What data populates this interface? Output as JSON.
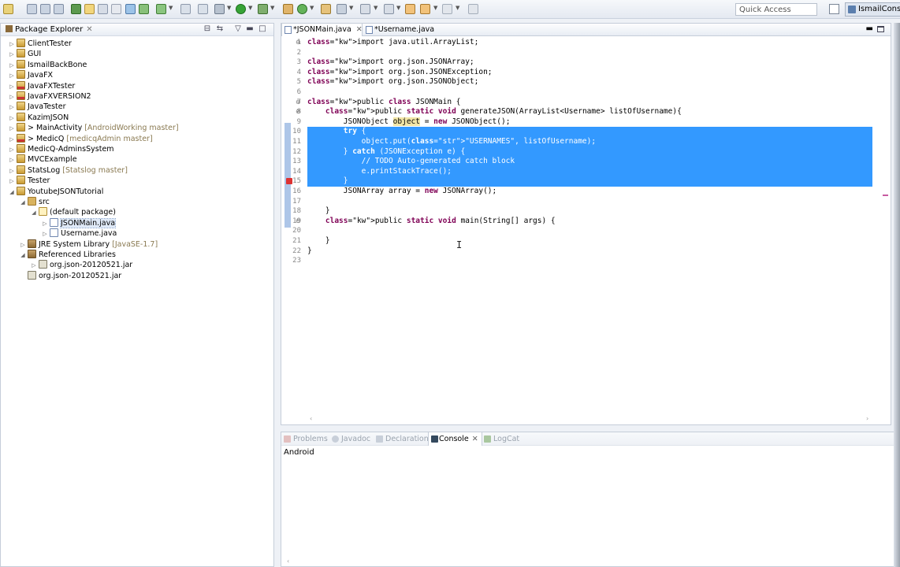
{
  "toolbar": {
    "quick_access_placeholder": "Quick Access",
    "perspective_label": "IsmailCons"
  },
  "package_explorer": {
    "title": "Package Explorer",
    "items": [
      {
        "label": "ClientTester",
        "deco": "",
        "icon": "project-icon",
        "twisty": "▷"
      },
      {
        "label": "GUI",
        "deco": "",
        "icon": "project-icon",
        "twisty": "▷"
      },
      {
        "label": "IsmailBackBone",
        "deco": "",
        "icon": "project-icon",
        "twisty": "▷"
      },
      {
        "label": "JavaFX",
        "deco": "",
        "icon": "project-icon",
        "twisty": "▷"
      },
      {
        "label": "JavaFXTester",
        "deco": "",
        "icon": "project-error-icon",
        "twisty": "▷"
      },
      {
        "label": "JavaFXVERSION2",
        "deco": "",
        "icon": "project-error-icon",
        "twisty": "▷"
      },
      {
        "label": "JavaTester",
        "deco": "",
        "icon": "project-icon",
        "twisty": "▷"
      },
      {
        "label": "KazimJSON",
        "deco": "",
        "icon": "project-icon",
        "twisty": "▷"
      },
      {
        "label": "> MainActivity",
        "deco": "[AndroidWorking master]",
        "icon": "project-icon",
        "twisty": "▷"
      },
      {
        "label": "> MedicQ",
        "deco": "[medicqAdmin master]",
        "icon": "project-error-icon",
        "twisty": "▷"
      },
      {
        "label": "MedicQ-AdminsSystem",
        "deco": "",
        "icon": "project-icon",
        "twisty": "▷"
      },
      {
        "label": "MVCExample",
        "deco": "",
        "icon": "project-icon",
        "twisty": "▷"
      },
      {
        "label": "StatsLog",
        "deco": "[Statslog master]",
        "icon": "project-icon",
        "twisty": "▷"
      },
      {
        "label": "Tester",
        "deco": "",
        "icon": "project-icon",
        "twisty": "▷"
      },
      {
        "label": "YoutubeJSONTutorial",
        "deco": "",
        "icon": "project-icon",
        "twisty": "◢"
      },
      {
        "label": "src",
        "deco": "",
        "icon": "source-folder-icon",
        "twisty": "◢"
      },
      {
        "label": "(default package)",
        "deco": "",
        "icon": "package-icon",
        "twisty": "◢"
      },
      {
        "label": "JSONMain.java",
        "deco": "",
        "icon": "java-file-icon",
        "twisty": "▷"
      },
      {
        "label": "Username.java",
        "deco": "",
        "icon": "java-file-icon",
        "twisty": "▷"
      },
      {
        "label": "JRE System Library",
        "deco": "[JavaSE-1.7]",
        "icon": "library-icon",
        "twisty": "▷"
      },
      {
        "label": "Referenced Libraries",
        "deco": "",
        "icon": "library-icon",
        "twisty": "◢"
      },
      {
        "label": "org.json-20120521.jar",
        "deco": "",
        "icon": "jar-icon",
        "twisty": "▷"
      },
      {
        "label": "org.json-20120521.jar",
        "deco": "",
        "icon": "jar-icon",
        "twisty": ""
      }
    ]
  },
  "editor": {
    "tabs": [
      {
        "label": "*JSONMain.java",
        "active": true
      },
      {
        "label": "*Username.java",
        "active": false
      }
    ],
    "line_numbers": [
      "1",
      "2",
      "3",
      "4",
      "5",
      "6",
      "7",
      "8",
      "9",
      "10",
      "11",
      "12",
      "13",
      "14",
      "15",
      "16",
      "17",
      "18",
      "19",
      "20",
      "21",
      "22",
      "23"
    ],
    "lines": [
      "import java.util.ArrayList;",
      "",
      "import org.json.JSONArray;",
      "import org.json.JSONException;",
      "import org.json.JSONObject;",
      "",
      "public class JSONMain {",
      "    public static void generateJSON(ArrayList<Username> listOfUsername){",
      "        JSONObject object = new JSONObject();",
      "        try {",
      "            object.put(\"USERNAMES\", listOfUsername);",
      "        } catch (JSONException e) {",
      "            // TODO Auto-generated catch block",
      "            e.printStackTrace();",
      "        }",
      "        JSONArray array = new JSONArray();",
      "",
      "    }",
      "    public static void main(String[] args) {",
      "",
      "    }",
      "}",
      ""
    ],
    "selected_lines": [
      10,
      11,
      12,
      13,
      14,
      15
    ]
  },
  "console": {
    "tabs": [
      {
        "label": "Problems",
        "active": false
      },
      {
        "label": "Javadoc",
        "active": false
      },
      {
        "label": "Declaration",
        "active": false
      },
      {
        "label": "Console",
        "active": true
      },
      {
        "label": "LogCat",
        "active": false
      }
    ],
    "output_label": "Android"
  },
  "colors": {
    "selection": "#3399ff",
    "keyword": "#7f0055",
    "string": "#2a00ff",
    "comment": "#3f7f5f"
  }
}
